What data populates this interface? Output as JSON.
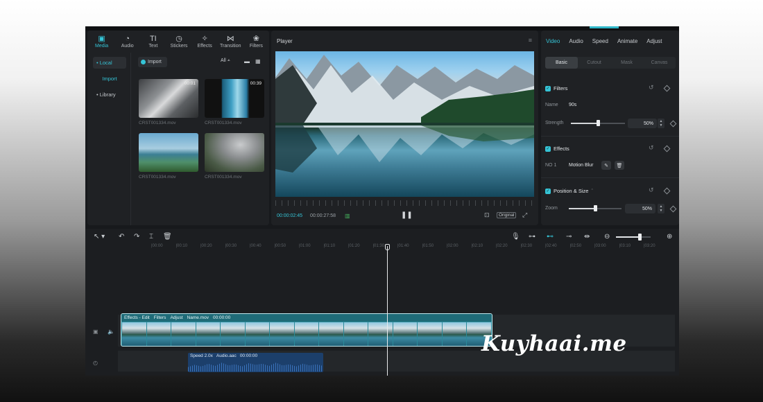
{
  "media": {
    "tabs": [
      {
        "label": "Media",
        "icon": "media-icon",
        "glyph": "▣"
      },
      {
        "label": "Audio",
        "icon": "audio-icon",
        "glyph": "◔"
      },
      {
        "label": "Text",
        "icon": "text-icon",
        "glyph": "TI"
      },
      {
        "label": "Stickers",
        "icon": "stickers-icon",
        "glyph": "◷"
      },
      {
        "label": "Effects",
        "icon": "effects-icon",
        "glyph": "✧"
      },
      {
        "label": "Transition",
        "icon": "transition-icon",
        "glyph": "⋈"
      },
      {
        "label": "Filters",
        "icon": "filters-icon",
        "glyph": "❀"
      }
    ],
    "side": {
      "local": "• Local",
      "import": "Import",
      "library": "• Library"
    },
    "import_button": "Import",
    "filter_all": "All ⩡",
    "clips": [
      {
        "duration": "00:01",
        "name": "CRST001334.mov"
      },
      {
        "duration": "00:39",
        "name": "CRST001334.mov"
      },
      {
        "duration": "",
        "name": "CRST001334.mov"
      },
      {
        "duration": "",
        "name": "CRST001334.mov"
      }
    ]
  },
  "player": {
    "title": "Player",
    "current_time": "00:00:02:45",
    "total_time": "00:00:27:58",
    "ratio_label": "Original"
  },
  "props": {
    "tabs": [
      "Video",
      "Audio",
      "Speed",
      "Animate",
      "Adjust"
    ],
    "subtabs": [
      "Basic",
      "Cutout",
      "Mask",
      "Canvas"
    ],
    "filters": {
      "title": "Filters",
      "name_label": "Name",
      "name_value": "90s",
      "strength_label": "Strength",
      "strength_value": "50%",
      "strength": 0.5
    },
    "effects": {
      "title": "Effects",
      "row_label": "NO 1",
      "row_value": "Motion Blur"
    },
    "position": {
      "title": "Position & Size",
      "zoom_label": "Zoom",
      "zoom_value": "50%",
      "zoom": 0.5
    }
  },
  "timeline": {
    "ticks": [
      "|00:00",
      "|00:10",
      "|00:20",
      "|00:30",
      "|00:40",
      "|00:50",
      "|01:00",
      "|01:10",
      "|01:20",
      "|01:30",
      "|01:40",
      "|01:50",
      "|02:00",
      "|02:10",
      "|02:20",
      "|02:30",
      "|02:40",
      "|02:50",
      "|03:00",
      "|03:10",
      "|03:20"
    ],
    "video_clip": {
      "effects": "Effects - Edit",
      "filters": "Filters",
      "adjust": "Adjust",
      "name": "Name.mov",
      "time": "00:00:00"
    },
    "audio_clip": {
      "speed": "Speed 2.0x",
      "name": "Audio.aac",
      "time": "00:00:00"
    }
  },
  "watermark": "Kuyhaai.me",
  "colors": {
    "accent": "#35c4d6",
    "panel": "#1f2124",
    "app": "#17191c"
  }
}
